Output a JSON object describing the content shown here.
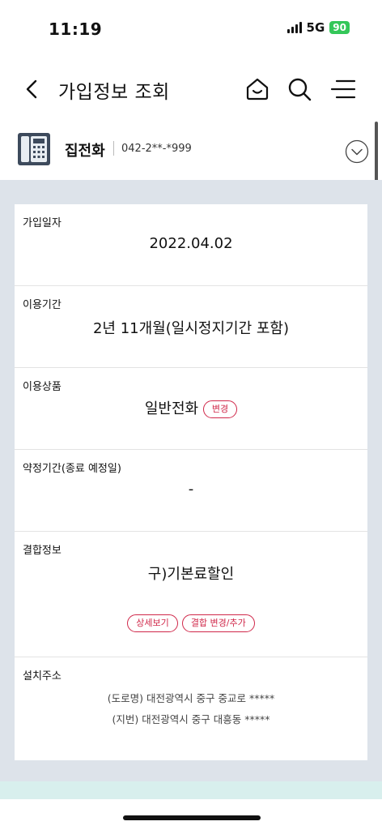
{
  "status_bar": {
    "time": "11:19",
    "network": "5G",
    "battery": "90"
  },
  "header": {
    "title": "가입정보 조회"
  },
  "service": {
    "name": "집전화",
    "number": "042-2**-*999"
  },
  "sections": {
    "join_date": {
      "label": "가입일자",
      "value": "2022.04.02"
    },
    "usage_period": {
      "label": "이용기간",
      "value": "2년 11개월(일시정지기간 포함)"
    },
    "product": {
      "label": "이용상품",
      "value": "일반전화",
      "change_button": "변경"
    },
    "contract": {
      "label": "약정기간(종료 예정일)",
      "value": "-"
    },
    "bundle": {
      "label": "결합정보",
      "value": "구)기본료할인",
      "detail_button": "상세보기",
      "change_button": "결합 변경/추가"
    },
    "address": {
      "label": "설치주소",
      "road": "(도로명) 대전광역시 중구 중교로 *****",
      "lot": "(지번) 대전광역시 중구 대흥동 *****"
    }
  },
  "colors": {
    "accent": "#d0284a",
    "background": "#dde3ea",
    "battery": "#34c759",
    "strip": "#d8efed"
  },
  "icons": [
    "back-arrow-icon",
    "home-icon",
    "search-icon",
    "menu-icon",
    "telephone-icon",
    "chevron-down-circle-icon"
  ]
}
